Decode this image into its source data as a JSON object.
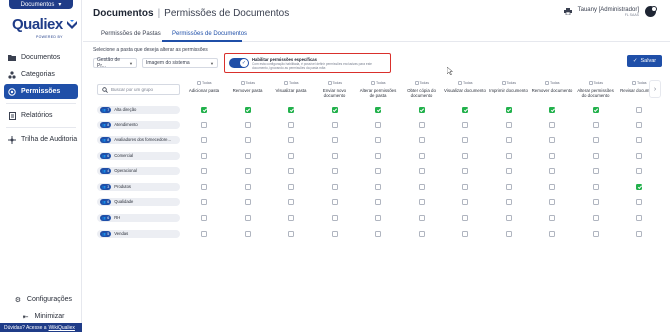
{
  "app": {
    "module_label": "Documentos",
    "logo_text": "Qualiex",
    "logo_sub": "POWERED BY"
  },
  "sidebar": {
    "items": [
      {
        "label": "Documentos",
        "icon": "folder-icon",
        "active": false
      },
      {
        "label": "Categorias",
        "icon": "categories-icon",
        "active": false
      },
      {
        "label": "Permissões",
        "icon": "permissions-icon",
        "active": true
      },
      {
        "label": "Relatórios",
        "icon": "report-icon",
        "active": false
      },
      {
        "label": "Trilha de Auditoria",
        "icon": "audit-trail-icon",
        "active": false
      }
    ],
    "settings_label": "Configurações",
    "minimize_label": "Minimizar",
    "help_text": "Dúvidas? Acesse a",
    "help_link": "WikiQualiex"
  },
  "header": {
    "title": "Documentos",
    "subtitle": "Permissões de Documentos",
    "user_name": "Tauany [Administrador]",
    "user_role": "FL SAAS"
  },
  "tabs": [
    {
      "label": "Permissões de Pastas",
      "active": false
    },
    {
      "label": "Permissões de Documentos",
      "active": true
    }
  ],
  "filters": {
    "label": "Selecione a pasta que deseja alterar as permissões",
    "folder_value": "Gestão de Pr...",
    "doc_value": "Imagem do sistema"
  },
  "specific_permissions": {
    "enabled": true,
    "title": "Habilitar permissões específicas",
    "description": "Com esta configuração habilitada, é possível definir permissões exclusivas para este documento, ignorando as permissões da pasta mãe."
  },
  "save_label": "Salvar",
  "search_placeholder": "Buscar por um grupo",
  "todas_label": "Todas",
  "columns": [
    "Adicionar pasta",
    "Remover pasta",
    "Visualizar pasta",
    "Enviar novo documento",
    "Alterar permissões de pasta",
    "Obter cópia do documento",
    "Visualizar documento",
    "Imprimir documento",
    "Remover documento",
    "Alterar permissões do documento",
    "Revisar documento"
  ],
  "groups": [
    {
      "count": "7",
      "name": "Alta direção",
      "checks": [
        1,
        1,
        1,
        1,
        1,
        1,
        1,
        1,
        1,
        1,
        0
      ]
    },
    {
      "count": "8",
      "name": "Atendimento",
      "checks": [
        0,
        0,
        0,
        0,
        0,
        0,
        0,
        0,
        0,
        0,
        0
      ]
    },
    {
      "count": "8",
      "name": "Avaliadores dos fornecedore...",
      "checks": [
        0,
        0,
        0,
        0,
        0,
        0,
        0,
        0,
        0,
        0,
        0
      ]
    },
    {
      "count": "6",
      "name": "Comercial",
      "checks": [
        0,
        0,
        0,
        0,
        0,
        0,
        0,
        0,
        0,
        0,
        0
      ]
    },
    {
      "count": "4",
      "name": "Operacional",
      "checks": [
        0,
        0,
        0,
        0,
        0,
        0,
        0,
        0,
        0,
        0,
        0
      ]
    },
    {
      "count": "3",
      "name": "Produtos",
      "checks": [
        0,
        0,
        0,
        0,
        0,
        0,
        0,
        0,
        0,
        0,
        1
      ]
    },
    {
      "count": "6",
      "name": "Qualidade",
      "checks": [
        0,
        0,
        0,
        0,
        0,
        0,
        0,
        0,
        0,
        0,
        0
      ]
    },
    {
      "count": "6",
      "name": "RH",
      "checks": [
        0,
        0,
        0,
        0,
        0,
        0,
        0,
        0,
        0,
        0,
        0
      ]
    },
    {
      "count": "5",
      "name": "Vendas",
      "checks": [
        0,
        0,
        0,
        0,
        0,
        0,
        0,
        0,
        0,
        0,
        0
      ]
    }
  ],
  "colors": {
    "brand": "#1f3c88",
    "accent": "#1f4fa8",
    "check": "#22b14c",
    "highlight": "#d9302c"
  }
}
